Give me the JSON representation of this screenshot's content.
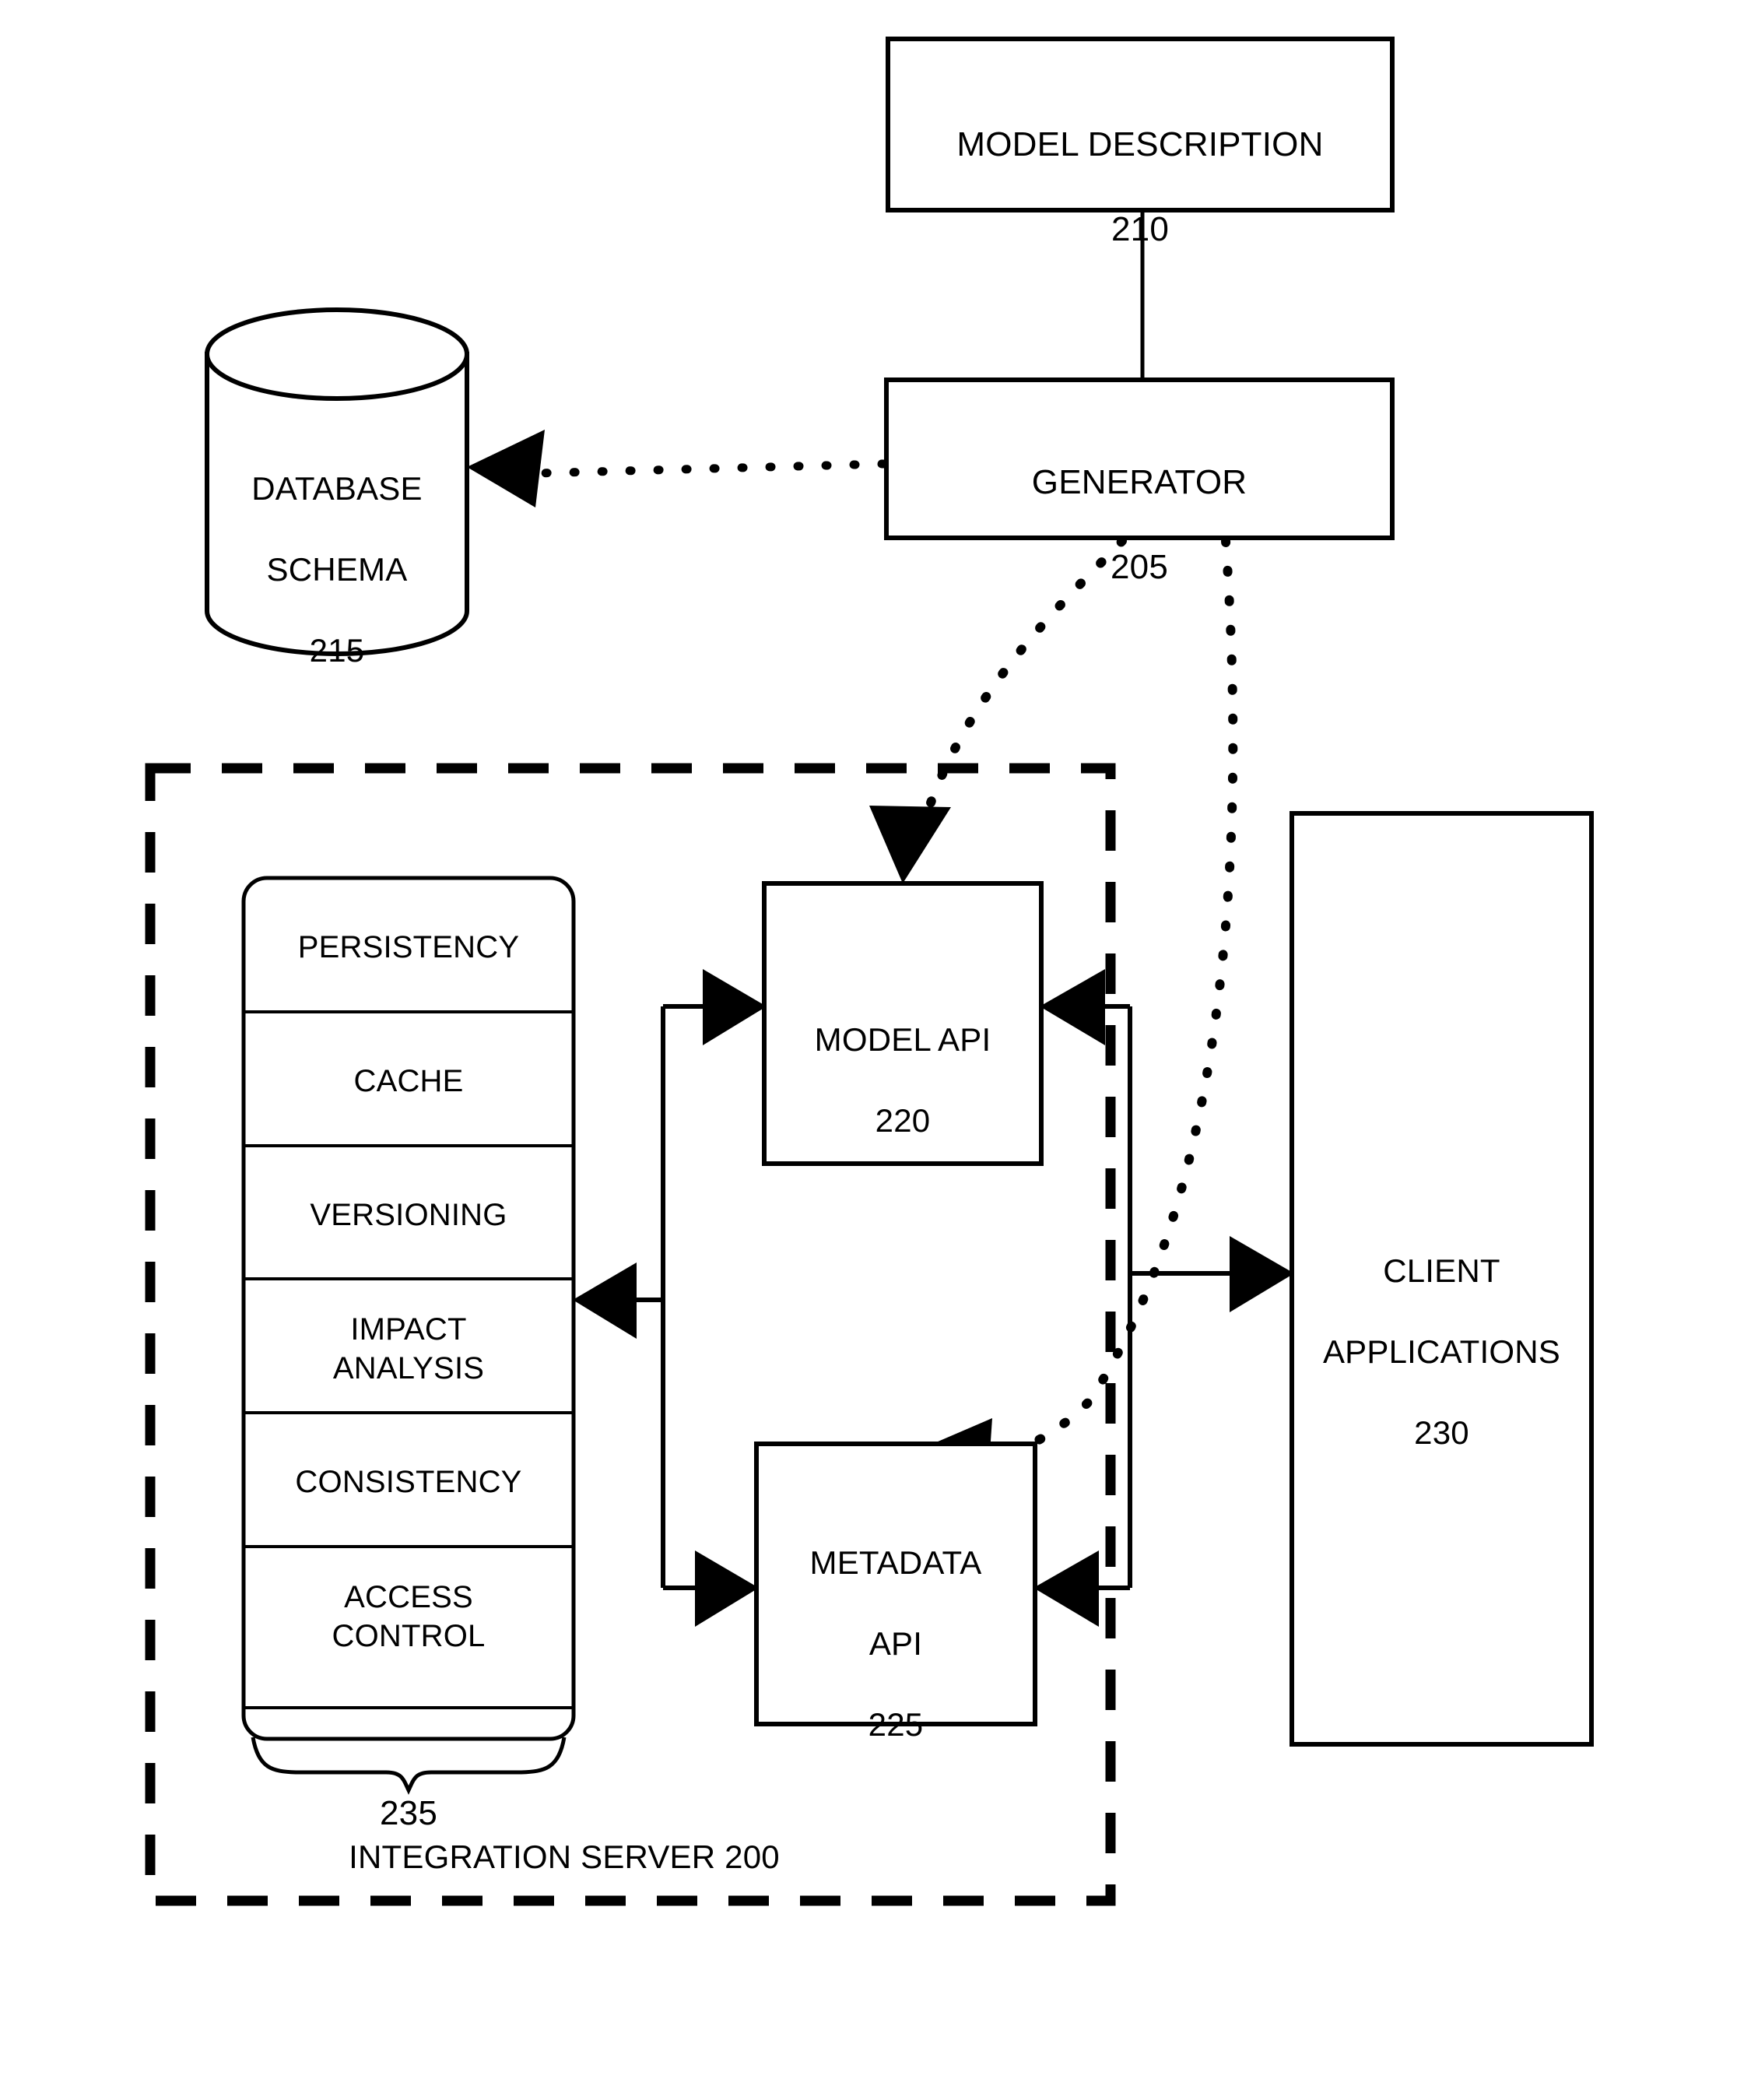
{
  "figure": {
    "kind": "patent-block-diagram",
    "background_color": "#ffffff",
    "stroke_color": "#000000"
  },
  "nodes": {
    "model_description": {
      "title": "MODEL DESCRIPTION",
      "ref": "210",
      "shape": "rectangle"
    },
    "generator": {
      "title": "GENERATOR",
      "ref": "205",
      "shape": "rectangle"
    },
    "database_schema": {
      "title_line1": "DATABASE",
      "title_line2": "SCHEMA",
      "ref": "215",
      "shape": "cylinder"
    },
    "model_api": {
      "title": "MODEL API",
      "ref": "220",
      "shape": "rectangle"
    },
    "metadata_api": {
      "title_line1": "METADATA",
      "title_line2": "API",
      "ref": "225",
      "shape": "rectangle"
    },
    "client_applications": {
      "title_line1": "CLIENT",
      "title_line2": "APPLICATIONS",
      "ref": "230",
      "shape": "rectangle"
    },
    "integration_server": {
      "caption": "INTEGRATION SERVER 200",
      "shape": "dashed-boundary"
    },
    "services_stack": {
      "brace_ref": "235",
      "shape": "rounded-rectangle-stack",
      "items": [
        {
          "label": "PERSISTENCY"
        },
        {
          "label": "CACHE"
        },
        {
          "label": "VERSIONING"
        },
        {
          "label": "IMPACT\nANALYSIS"
        },
        {
          "label": "CONSISTENCY"
        },
        {
          "label": "ACCESS\nCONTROL"
        }
      ]
    }
  },
  "connectors": [
    {
      "name": "model-description-to-generator",
      "style": "solid",
      "arrow": "none"
    },
    {
      "name": "generator-to-database-schema",
      "style": "dotted",
      "arrow": "filled-triangle-left"
    },
    {
      "name": "generator-to-model-api",
      "style": "dotted-curve",
      "arrow": "filled-triangle-down"
    },
    {
      "name": "generator-to-metadata-api",
      "style": "dotted-curve",
      "arrow": "filled-triangle-left"
    },
    {
      "name": "services-to-model-api",
      "style": "solid",
      "arrow": "filled-triangle-right"
    },
    {
      "name": "services-to-metadata-api",
      "style": "solid",
      "arrow": "filled-triangle-right"
    },
    {
      "name": "apis-to-services",
      "style": "solid",
      "arrow": "filled-triangle-left"
    },
    {
      "name": "client-applications-to-model-api",
      "style": "solid",
      "arrow": "filled-triangle-left"
    },
    {
      "name": "client-applications-to-metadata-api",
      "style": "solid",
      "arrow": "filled-triangle-left"
    },
    {
      "name": "apis-to-client-applications",
      "style": "solid",
      "arrow": "filled-triangle-right"
    }
  ]
}
